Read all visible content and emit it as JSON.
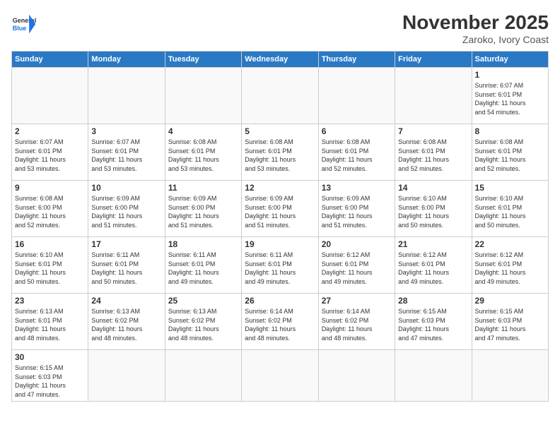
{
  "header": {
    "logo_general": "General",
    "logo_blue": "Blue",
    "month_title": "November 2025",
    "location": "Zaroko, Ivory Coast"
  },
  "days_of_week": [
    "Sunday",
    "Monday",
    "Tuesday",
    "Wednesday",
    "Thursday",
    "Friday",
    "Saturday"
  ],
  "weeks": [
    [
      {
        "day": "",
        "info": ""
      },
      {
        "day": "",
        "info": ""
      },
      {
        "day": "",
        "info": ""
      },
      {
        "day": "",
        "info": ""
      },
      {
        "day": "",
        "info": ""
      },
      {
        "day": "",
        "info": ""
      },
      {
        "day": "1",
        "info": "Sunrise: 6:07 AM\nSunset: 6:01 PM\nDaylight: 11 hours\nand 54 minutes."
      }
    ],
    [
      {
        "day": "2",
        "info": "Sunrise: 6:07 AM\nSunset: 6:01 PM\nDaylight: 11 hours\nand 53 minutes."
      },
      {
        "day": "3",
        "info": "Sunrise: 6:07 AM\nSunset: 6:01 PM\nDaylight: 11 hours\nand 53 minutes."
      },
      {
        "day": "4",
        "info": "Sunrise: 6:08 AM\nSunset: 6:01 PM\nDaylight: 11 hours\nand 53 minutes."
      },
      {
        "day": "5",
        "info": "Sunrise: 6:08 AM\nSunset: 6:01 PM\nDaylight: 11 hours\nand 53 minutes."
      },
      {
        "day": "6",
        "info": "Sunrise: 6:08 AM\nSunset: 6:01 PM\nDaylight: 11 hours\nand 52 minutes."
      },
      {
        "day": "7",
        "info": "Sunrise: 6:08 AM\nSunset: 6:01 PM\nDaylight: 11 hours\nand 52 minutes."
      },
      {
        "day": "8",
        "info": "Sunrise: 6:08 AM\nSunset: 6:01 PM\nDaylight: 11 hours\nand 52 minutes."
      }
    ],
    [
      {
        "day": "9",
        "info": "Sunrise: 6:08 AM\nSunset: 6:00 PM\nDaylight: 11 hours\nand 52 minutes."
      },
      {
        "day": "10",
        "info": "Sunrise: 6:09 AM\nSunset: 6:00 PM\nDaylight: 11 hours\nand 51 minutes."
      },
      {
        "day": "11",
        "info": "Sunrise: 6:09 AM\nSunset: 6:00 PM\nDaylight: 11 hours\nand 51 minutes."
      },
      {
        "day": "12",
        "info": "Sunrise: 6:09 AM\nSunset: 6:00 PM\nDaylight: 11 hours\nand 51 minutes."
      },
      {
        "day": "13",
        "info": "Sunrise: 6:09 AM\nSunset: 6:00 PM\nDaylight: 11 hours\nand 51 minutes."
      },
      {
        "day": "14",
        "info": "Sunrise: 6:10 AM\nSunset: 6:00 PM\nDaylight: 11 hours\nand 50 minutes."
      },
      {
        "day": "15",
        "info": "Sunrise: 6:10 AM\nSunset: 6:01 PM\nDaylight: 11 hours\nand 50 minutes."
      }
    ],
    [
      {
        "day": "16",
        "info": "Sunrise: 6:10 AM\nSunset: 6:01 PM\nDaylight: 11 hours\nand 50 minutes."
      },
      {
        "day": "17",
        "info": "Sunrise: 6:11 AM\nSunset: 6:01 PM\nDaylight: 11 hours\nand 50 minutes."
      },
      {
        "day": "18",
        "info": "Sunrise: 6:11 AM\nSunset: 6:01 PM\nDaylight: 11 hours\nand 49 minutes."
      },
      {
        "day": "19",
        "info": "Sunrise: 6:11 AM\nSunset: 6:01 PM\nDaylight: 11 hours\nand 49 minutes."
      },
      {
        "day": "20",
        "info": "Sunrise: 6:12 AM\nSunset: 6:01 PM\nDaylight: 11 hours\nand 49 minutes."
      },
      {
        "day": "21",
        "info": "Sunrise: 6:12 AM\nSunset: 6:01 PM\nDaylight: 11 hours\nand 49 minutes."
      },
      {
        "day": "22",
        "info": "Sunrise: 6:12 AM\nSunset: 6:01 PM\nDaylight: 11 hours\nand 49 minutes."
      }
    ],
    [
      {
        "day": "23",
        "info": "Sunrise: 6:13 AM\nSunset: 6:01 PM\nDaylight: 11 hours\nand 48 minutes."
      },
      {
        "day": "24",
        "info": "Sunrise: 6:13 AM\nSunset: 6:02 PM\nDaylight: 11 hours\nand 48 minutes."
      },
      {
        "day": "25",
        "info": "Sunrise: 6:13 AM\nSunset: 6:02 PM\nDaylight: 11 hours\nand 48 minutes."
      },
      {
        "day": "26",
        "info": "Sunrise: 6:14 AM\nSunset: 6:02 PM\nDaylight: 11 hours\nand 48 minutes."
      },
      {
        "day": "27",
        "info": "Sunrise: 6:14 AM\nSunset: 6:02 PM\nDaylight: 11 hours\nand 48 minutes."
      },
      {
        "day": "28",
        "info": "Sunrise: 6:15 AM\nSunset: 6:03 PM\nDaylight: 11 hours\nand 47 minutes."
      },
      {
        "day": "29",
        "info": "Sunrise: 6:15 AM\nSunset: 6:03 PM\nDaylight: 11 hours\nand 47 minutes."
      }
    ],
    [
      {
        "day": "30",
        "info": "Sunrise: 6:15 AM\nSunset: 6:03 PM\nDaylight: 11 hours\nand 47 minutes."
      },
      {
        "day": "",
        "info": ""
      },
      {
        "day": "",
        "info": ""
      },
      {
        "day": "",
        "info": ""
      },
      {
        "day": "",
        "info": ""
      },
      {
        "day": "",
        "info": ""
      },
      {
        "day": "",
        "info": ""
      }
    ]
  ]
}
